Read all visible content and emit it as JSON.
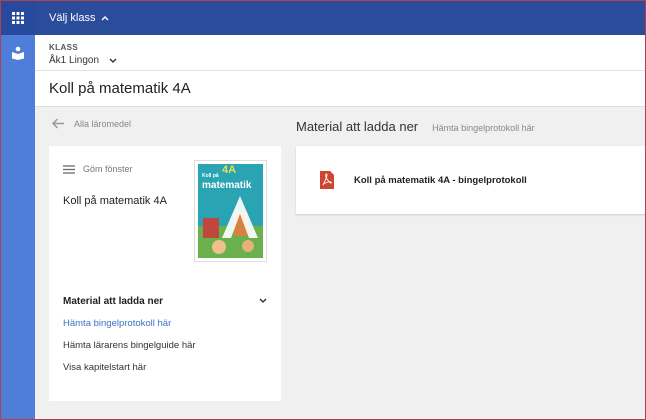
{
  "topbar": {
    "class_picker_label": "Välj klass"
  },
  "class_bar": {
    "label": "KLASS",
    "selected_value": "Åk1 Lingon"
  },
  "page": {
    "title": "Koll på matematik 4A"
  },
  "nav": {
    "back_label": "Alla läromedel"
  },
  "left_card": {
    "hide_label": "Göm fönster",
    "product_title": "Koll på matematik 4A",
    "cover": {
      "grade": "4A",
      "line1": "Koll på",
      "line2": "matematik"
    },
    "section_title": "Material att ladda ner",
    "links": [
      {
        "label": "Hämta bingelprotokoll här",
        "active": true
      },
      {
        "label": "Hämta lärarens bingelguide här",
        "active": false
      },
      {
        "label": "Visa kapitelstart här",
        "active": false
      }
    ]
  },
  "main": {
    "heading": "Material att ladda ner",
    "subheading": "Hämta bingelprotokoll här",
    "documents": [
      {
        "name": "Koll på matematik 4A - bingelprotokoll",
        "icon": "pdf-icon"
      }
    ]
  },
  "colors": {
    "rail": "#4f7ed8",
    "topbar": "#2b4c9b",
    "link_active": "#3d6fc9",
    "pdf": "#d0452f"
  }
}
